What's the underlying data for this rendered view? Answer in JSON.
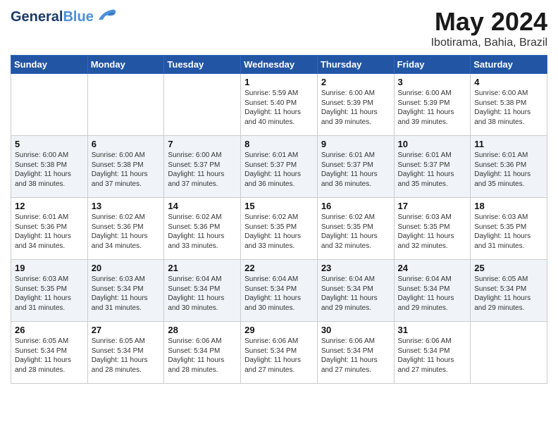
{
  "header": {
    "logo_general": "General",
    "logo_blue": "Blue",
    "month_title": "May 2024",
    "location": "Ibotirama, Bahia, Brazil"
  },
  "weekdays": [
    "Sunday",
    "Monday",
    "Tuesday",
    "Wednesday",
    "Thursday",
    "Friday",
    "Saturday"
  ],
  "weeks": [
    [
      {
        "day": "",
        "sunrise": "",
        "sunset": "",
        "daylight": ""
      },
      {
        "day": "",
        "sunrise": "",
        "sunset": "",
        "daylight": ""
      },
      {
        "day": "",
        "sunrise": "",
        "sunset": "",
        "daylight": ""
      },
      {
        "day": "1",
        "sunrise": "Sunrise: 5:59 AM",
        "sunset": "Sunset: 5:40 PM",
        "daylight": "Daylight: 11 hours and 40 minutes."
      },
      {
        "day": "2",
        "sunrise": "Sunrise: 6:00 AM",
        "sunset": "Sunset: 5:39 PM",
        "daylight": "Daylight: 11 hours and 39 minutes."
      },
      {
        "day": "3",
        "sunrise": "Sunrise: 6:00 AM",
        "sunset": "Sunset: 5:39 PM",
        "daylight": "Daylight: 11 hours and 39 minutes."
      },
      {
        "day": "4",
        "sunrise": "Sunrise: 6:00 AM",
        "sunset": "Sunset: 5:38 PM",
        "daylight": "Daylight: 11 hours and 38 minutes."
      }
    ],
    [
      {
        "day": "5",
        "sunrise": "Sunrise: 6:00 AM",
        "sunset": "Sunset: 5:38 PM",
        "daylight": "Daylight: 11 hours and 38 minutes."
      },
      {
        "day": "6",
        "sunrise": "Sunrise: 6:00 AM",
        "sunset": "Sunset: 5:38 PM",
        "daylight": "Daylight: 11 hours and 37 minutes."
      },
      {
        "day": "7",
        "sunrise": "Sunrise: 6:00 AM",
        "sunset": "Sunset: 5:37 PM",
        "daylight": "Daylight: 11 hours and 37 minutes."
      },
      {
        "day": "8",
        "sunrise": "Sunrise: 6:01 AM",
        "sunset": "Sunset: 5:37 PM",
        "daylight": "Daylight: 11 hours and 36 minutes."
      },
      {
        "day": "9",
        "sunrise": "Sunrise: 6:01 AM",
        "sunset": "Sunset: 5:37 PM",
        "daylight": "Daylight: 11 hours and 36 minutes."
      },
      {
        "day": "10",
        "sunrise": "Sunrise: 6:01 AM",
        "sunset": "Sunset: 5:37 PM",
        "daylight": "Daylight: 11 hours and 35 minutes."
      },
      {
        "day": "11",
        "sunrise": "Sunrise: 6:01 AM",
        "sunset": "Sunset: 5:36 PM",
        "daylight": "Daylight: 11 hours and 35 minutes."
      }
    ],
    [
      {
        "day": "12",
        "sunrise": "Sunrise: 6:01 AM",
        "sunset": "Sunset: 5:36 PM",
        "daylight": "Daylight: 11 hours and 34 minutes."
      },
      {
        "day": "13",
        "sunrise": "Sunrise: 6:02 AM",
        "sunset": "Sunset: 5:36 PM",
        "daylight": "Daylight: 11 hours and 34 minutes."
      },
      {
        "day": "14",
        "sunrise": "Sunrise: 6:02 AM",
        "sunset": "Sunset: 5:36 PM",
        "daylight": "Daylight: 11 hours and 33 minutes."
      },
      {
        "day": "15",
        "sunrise": "Sunrise: 6:02 AM",
        "sunset": "Sunset: 5:35 PM",
        "daylight": "Daylight: 11 hours and 33 minutes."
      },
      {
        "day": "16",
        "sunrise": "Sunrise: 6:02 AM",
        "sunset": "Sunset: 5:35 PM",
        "daylight": "Daylight: 11 hours and 32 minutes."
      },
      {
        "day": "17",
        "sunrise": "Sunrise: 6:03 AM",
        "sunset": "Sunset: 5:35 PM",
        "daylight": "Daylight: 11 hours and 32 minutes."
      },
      {
        "day": "18",
        "sunrise": "Sunrise: 6:03 AM",
        "sunset": "Sunset: 5:35 PM",
        "daylight": "Daylight: 11 hours and 31 minutes."
      }
    ],
    [
      {
        "day": "19",
        "sunrise": "Sunrise: 6:03 AM",
        "sunset": "Sunset: 5:35 PM",
        "daylight": "Daylight: 11 hours and 31 minutes."
      },
      {
        "day": "20",
        "sunrise": "Sunrise: 6:03 AM",
        "sunset": "Sunset: 5:34 PM",
        "daylight": "Daylight: 11 hours and 31 minutes."
      },
      {
        "day": "21",
        "sunrise": "Sunrise: 6:04 AM",
        "sunset": "Sunset: 5:34 PM",
        "daylight": "Daylight: 11 hours and 30 minutes."
      },
      {
        "day": "22",
        "sunrise": "Sunrise: 6:04 AM",
        "sunset": "Sunset: 5:34 PM",
        "daylight": "Daylight: 11 hours and 30 minutes."
      },
      {
        "day": "23",
        "sunrise": "Sunrise: 6:04 AM",
        "sunset": "Sunset: 5:34 PM",
        "daylight": "Daylight: 11 hours and 29 minutes."
      },
      {
        "day": "24",
        "sunrise": "Sunrise: 6:04 AM",
        "sunset": "Sunset: 5:34 PM",
        "daylight": "Daylight: 11 hours and 29 minutes."
      },
      {
        "day": "25",
        "sunrise": "Sunrise: 6:05 AM",
        "sunset": "Sunset: 5:34 PM",
        "daylight": "Daylight: 11 hours and 29 minutes."
      }
    ],
    [
      {
        "day": "26",
        "sunrise": "Sunrise: 6:05 AM",
        "sunset": "Sunset: 5:34 PM",
        "daylight": "Daylight: 11 hours and 28 minutes."
      },
      {
        "day": "27",
        "sunrise": "Sunrise: 6:05 AM",
        "sunset": "Sunset: 5:34 PM",
        "daylight": "Daylight: 11 hours and 28 minutes."
      },
      {
        "day": "28",
        "sunrise": "Sunrise: 6:06 AM",
        "sunset": "Sunset: 5:34 PM",
        "daylight": "Daylight: 11 hours and 28 minutes."
      },
      {
        "day": "29",
        "sunrise": "Sunrise: 6:06 AM",
        "sunset": "Sunset: 5:34 PM",
        "daylight": "Daylight: 11 hours and 27 minutes."
      },
      {
        "day": "30",
        "sunrise": "Sunrise: 6:06 AM",
        "sunset": "Sunset: 5:34 PM",
        "daylight": "Daylight: 11 hours and 27 minutes."
      },
      {
        "day": "31",
        "sunrise": "Sunrise: 6:06 AM",
        "sunset": "Sunset: 5:34 PM",
        "daylight": "Daylight: 11 hours and 27 minutes."
      },
      {
        "day": "",
        "sunrise": "",
        "sunset": "",
        "daylight": ""
      }
    ]
  ]
}
